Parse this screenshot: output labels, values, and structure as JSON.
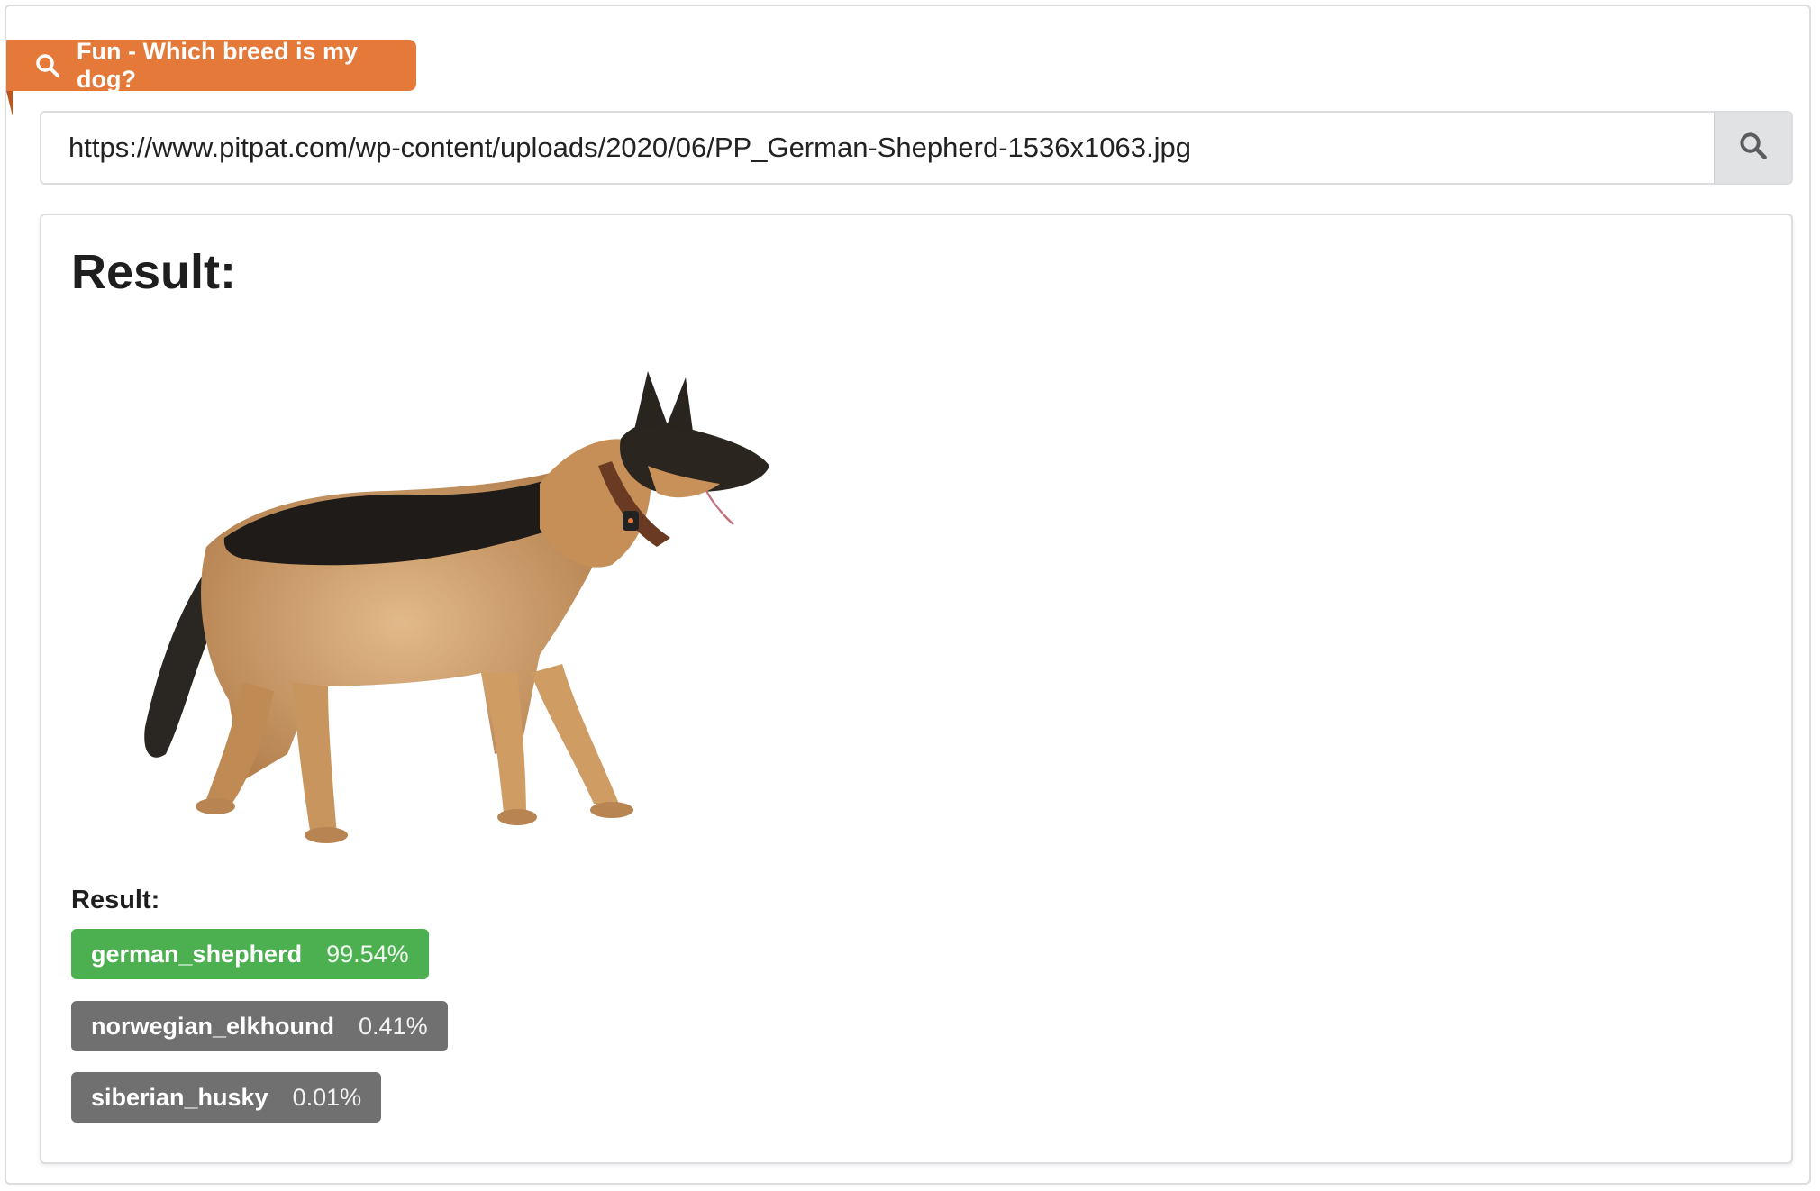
{
  "header": {
    "title": "Fun - Which breed is my dog?",
    "icon": "search-icon",
    "color": "#e4793a"
  },
  "search": {
    "url_value": "https://www.pitpat.com/wp-content/uploads/2020/06/PP_German-Shepherd-1536x1063.jpg",
    "button_icon": "search-icon"
  },
  "result": {
    "heading": "Result:",
    "sub_label": "Result:",
    "predictions": [
      {
        "breed": "german_shepherd",
        "confidence": "99.54%",
        "color": "#4cb050"
      },
      {
        "breed": "norwegian_elkhound",
        "confidence": "0.41%",
        "color": "#707070"
      },
      {
        "breed": "siberian_husky",
        "confidence": "0.01%",
        "color": "#707070"
      }
    ]
  }
}
